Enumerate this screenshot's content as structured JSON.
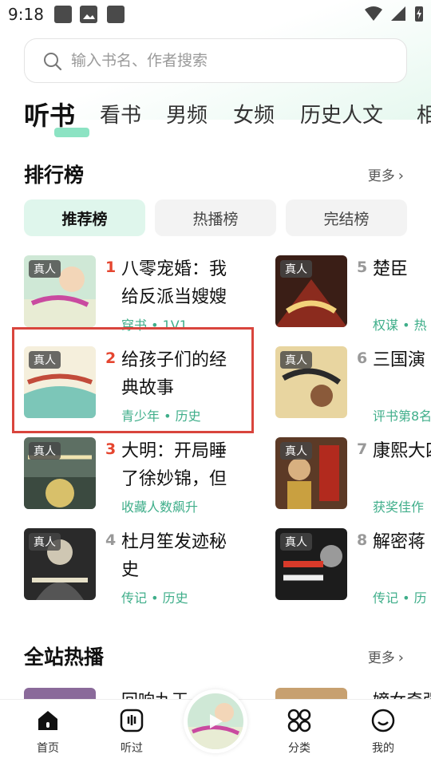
{
  "status_bar": {
    "time": "9:18"
  },
  "search": {
    "placeholder": "输入书名、作者搜索"
  },
  "tabs": [
    "听书",
    "看书",
    "男频",
    "女频",
    "历史人文",
    "相"
  ],
  "ranking": {
    "title": "排行榜",
    "more": "更多",
    "tabs": [
      "推荐榜",
      "热播榜",
      "完结榜"
    ],
    "books": [
      {
        "rank": "1",
        "title": "八零宠婚：我给反派当嫂嫂",
        "meta": "穿书 • 1V1",
        "tag": "真人"
      },
      {
        "rank": "2",
        "title": "给孩子们的经典故事",
        "meta": "青少年 • 历史",
        "tag": "真人"
      },
      {
        "rank": "3",
        "title": "大明：开局睡了徐妙锦，但",
        "meta": "收藏人数飙升",
        "tag": "真人"
      },
      {
        "rank": "4",
        "title": "杜月笙发迹秘史",
        "meta": "传记 • 历史",
        "tag": "真人"
      },
      {
        "rank": "5",
        "title": "楚臣",
        "meta": "权谋 • 热",
        "tag": "真人"
      },
      {
        "rank": "6",
        "title": "三国演",
        "meta": "评书第8名",
        "tag": "真人"
      },
      {
        "rank": "7",
        "title": "康熙大四册）",
        "meta": "获奖佳作",
        "tag": "真人"
      },
      {
        "rank": "8",
        "title": "解密蒋",
        "meta": "传记 • 历",
        "tag": "真人"
      }
    ]
  },
  "hot": {
    "title": "全站热播",
    "more": "更多",
    "peek_left": "回响九王",
    "peek_right": "嫡女奇强"
  },
  "bottom_nav": [
    "首页",
    "听过",
    "分类",
    "我的"
  ],
  "colors": {
    "accent": "#3fae8a",
    "rank_top": "#e5452f",
    "highlight": "#d9453d"
  }
}
